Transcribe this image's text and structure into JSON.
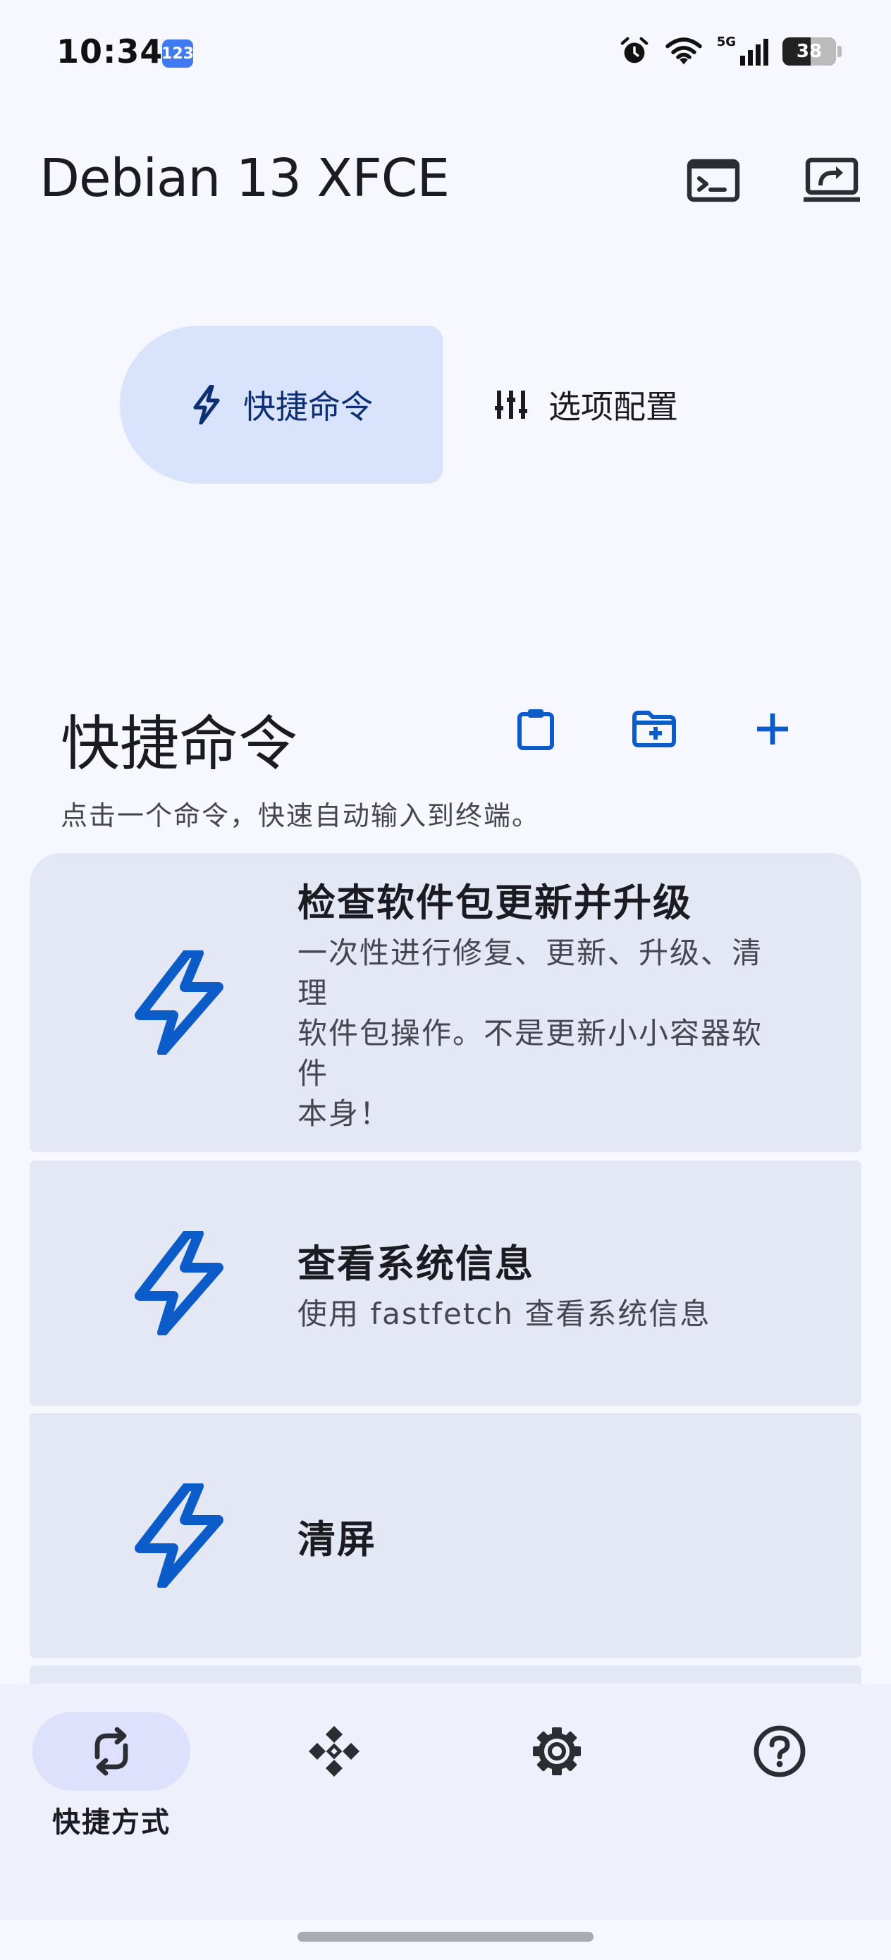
{
  "status_bar": {
    "time": "10:34",
    "badge": "123",
    "network": "5G",
    "battery": "38"
  },
  "app_bar": {
    "title": "Debian 13 XFCE",
    "actions": [
      "terminal-icon",
      "screen-share-icon"
    ]
  },
  "tabs": [
    {
      "label": "快捷命令",
      "icon": "bolt-icon",
      "selected": true
    },
    {
      "label": "选项配置",
      "icon": "sliders-icon",
      "selected": false
    }
  ],
  "section": {
    "title": "快捷命令",
    "subtitle": "点击一个命令，快速自动输入到终端。",
    "actions": [
      "clipboard-icon",
      "folder-add-icon",
      "add-icon"
    ]
  },
  "commands": [
    {
      "title": "检查软件包更新并升级",
      "desc_lines": [
        "一次性进行修复、更新、升级、清理",
        "软件包操作。不是更新小小容器软件",
        "本身！"
      ]
    },
    {
      "title": "查看系统信息",
      "desc_lines": [
        "使用 fastfetch 查看系统信息"
      ]
    },
    {
      "title": "清屏",
      "desc_lines": []
    }
  ],
  "bottom_nav": [
    {
      "label": "快捷方式",
      "icon": "swap-icon",
      "selected": true
    },
    {
      "label": "",
      "icon": "diamond-grid-icon",
      "selected": false
    },
    {
      "label": "",
      "icon": "gear-icon",
      "selected": false
    },
    {
      "label": "",
      "icon": "help-icon",
      "selected": false
    }
  ],
  "colors": {
    "accent": "#0b5cc9",
    "tab_active_bg": "#d9e3fb",
    "card_bg": "#e4e8f4",
    "nav_bg": "#eef0fb"
  }
}
